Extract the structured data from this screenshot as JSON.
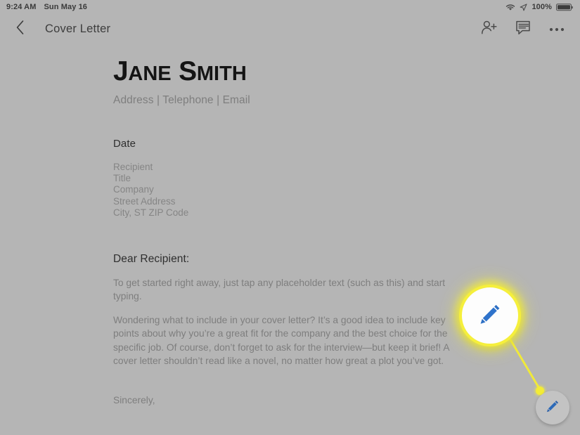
{
  "status_bar": {
    "clock": "9:24 AM",
    "date": "Sun May 16",
    "battery_percent": "100%",
    "icons": [
      "wifi-icon",
      "location-arrow-icon",
      "battery-icon"
    ]
  },
  "app_bar": {
    "back_label": "back-arrow-icon",
    "title": "Cover Letter",
    "actions": [
      {
        "name": "add-person-icon",
        "label": "Share"
      },
      {
        "name": "comment-icon",
        "label": "Comments"
      },
      {
        "name": "more-options-icon",
        "label": "More options"
      }
    ]
  },
  "document": {
    "name_first_cap": "J",
    "name_first_rest": "ANE",
    "name_last_cap": "S",
    "name_last_rest": "MITH",
    "contact_line": "Address | Telephone | Email",
    "date_placeholder": "Date",
    "recipient_block": [
      "Recipient",
      "Title",
      "Company",
      "Street Address",
      "City, ST ZIP Code"
    ],
    "salutation": "Dear Recipient:",
    "paragraph_1": "To get started right away, just tap any placeholder text (such as this) and start typing.",
    "paragraph_2": "Wondering what to include in your cover letter? It’s a good idea to include key points about why you’re a great fit for the company and the best choice for the specific job. Of course, don’t forget to ask for the interview—but keep it brief! A cover letter shouldn’t read like a novel, no matter how great a plot you’ve got.",
    "signoff": "Sincerely,"
  },
  "annotation": {
    "callout_icon": "pencil-edit-icon",
    "highlight_color": "#f3ec36",
    "line_color": "#f0e93a"
  },
  "fab": {
    "icon": "pencil-edit-icon",
    "label": "Edit",
    "icon_color": "#2d6fc4",
    "background_color": "#c3c3c3"
  }
}
